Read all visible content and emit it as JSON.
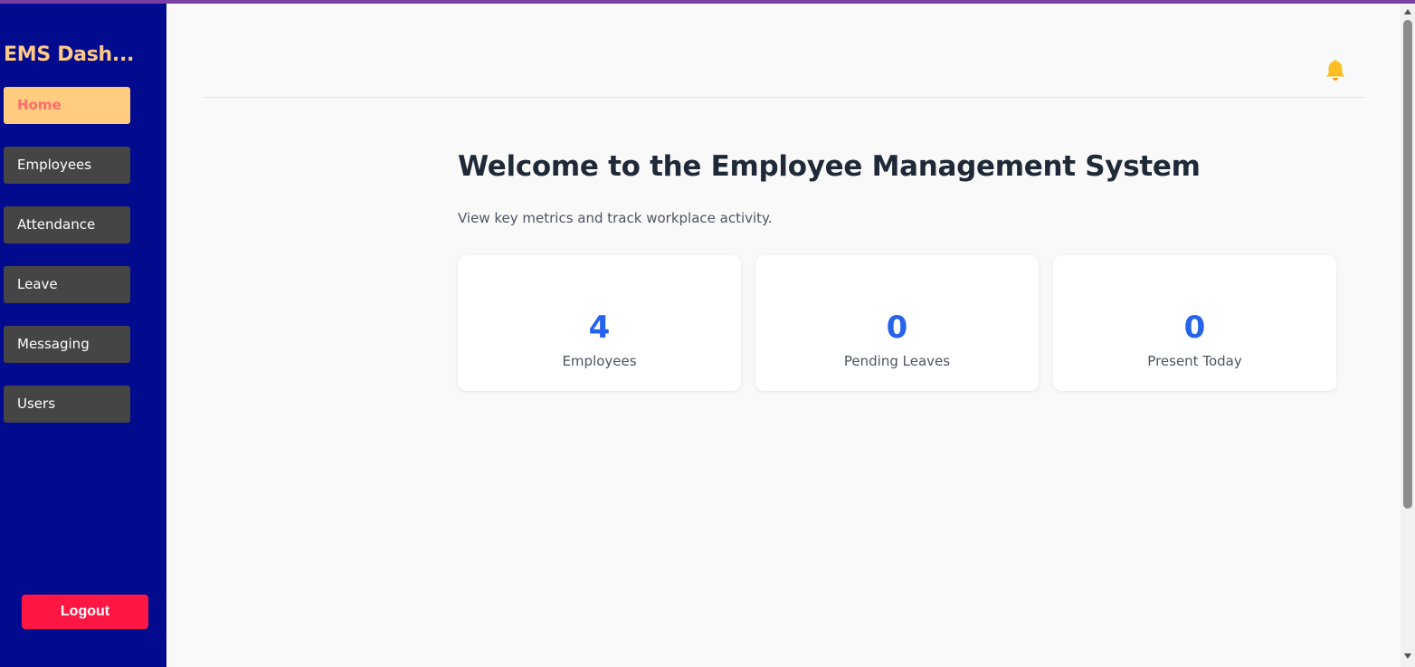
{
  "sidebar": {
    "brand": "EMS Dash...",
    "items": [
      {
        "label": "Home",
        "active": true
      },
      {
        "label": "Employees",
        "active": false
      },
      {
        "label": "Attendance",
        "active": false
      },
      {
        "label": "Leave",
        "active": false
      },
      {
        "label": "Messaging",
        "active": false
      },
      {
        "label": "Users",
        "active": false
      }
    ],
    "logout_label": "Logout"
  },
  "header": {
    "notification_icon": "bell-icon"
  },
  "main": {
    "title": "Welcome to the Employee Management System",
    "subtitle": "View key metrics and track workplace activity.",
    "stats": [
      {
        "value": "4",
        "label": "Employees"
      },
      {
        "value": "0",
        "label": "Pending Leaves"
      },
      {
        "value": "0",
        "label": "Present Today"
      }
    ]
  },
  "colors": {
    "sidebar_bg": "#020b8d",
    "brand": "#ffc985",
    "active_nav_bg": "#ffcc80",
    "active_nav_text": "#ff6b6b",
    "nav_bg": "#454545",
    "logout_bg": "#ff1744",
    "stat_value": "#2563eb",
    "bell": "#fbbf24"
  }
}
